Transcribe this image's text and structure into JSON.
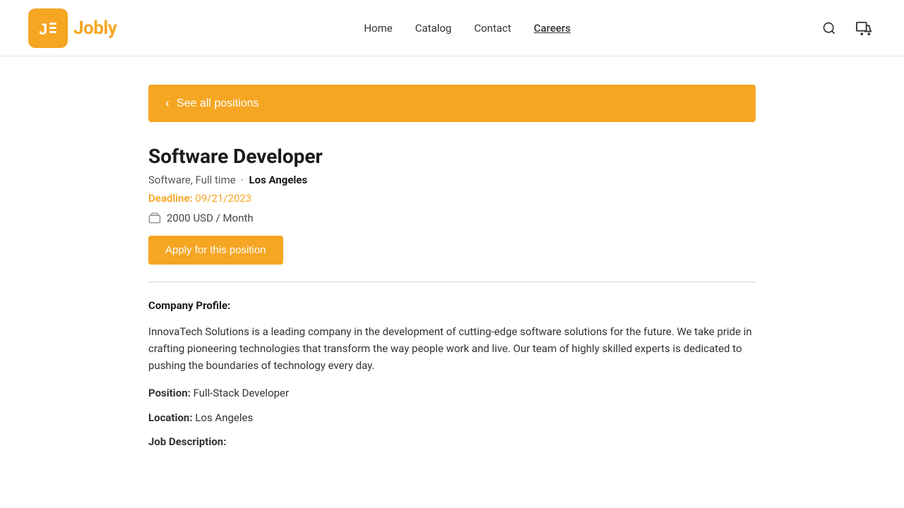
{
  "brand": {
    "logo_text": "Jobly"
  },
  "nav": {
    "items": [
      {
        "label": "Home",
        "active": false
      },
      {
        "label": "Catalog",
        "active": false
      },
      {
        "label": "Contact",
        "active": false
      },
      {
        "label": "Careers",
        "active": true
      }
    ]
  },
  "back_button": {
    "label": "See all positions"
  },
  "job": {
    "title": "Software Developer",
    "category": "Software",
    "type": "Full time",
    "location": "Los Angeles",
    "deadline_label": "Deadline:",
    "deadline_date": "09/21/2023",
    "salary": "2000 USD / Month",
    "apply_label": "Apply for this position"
  },
  "content": {
    "company_profile_label": "Company Profile:",
    "company_desc": "InnovaTech Solutions is a leading company in the development of cutting-edge software solutions for the future. We take pride in crafting pioneering technologies that transform the way people work and live. Our team of highly skilled experts is dedicated to pushing the boundaries of technology every day.",
    "position_label": "Position:",
    "position_value": "Full-Stack Developer",
    "location_label": "Location:",
    "location_value": "Los Angeles",
    "job_desc_label": "Job Description:"
  },
  "icons": {
    "search": "🔍",
    "cart": "🛒",
    "chevron_left": "‹",
    "salary_icon": "💼"
  },
  "colors": {
    "accent": "#f5a623"
  }
}
